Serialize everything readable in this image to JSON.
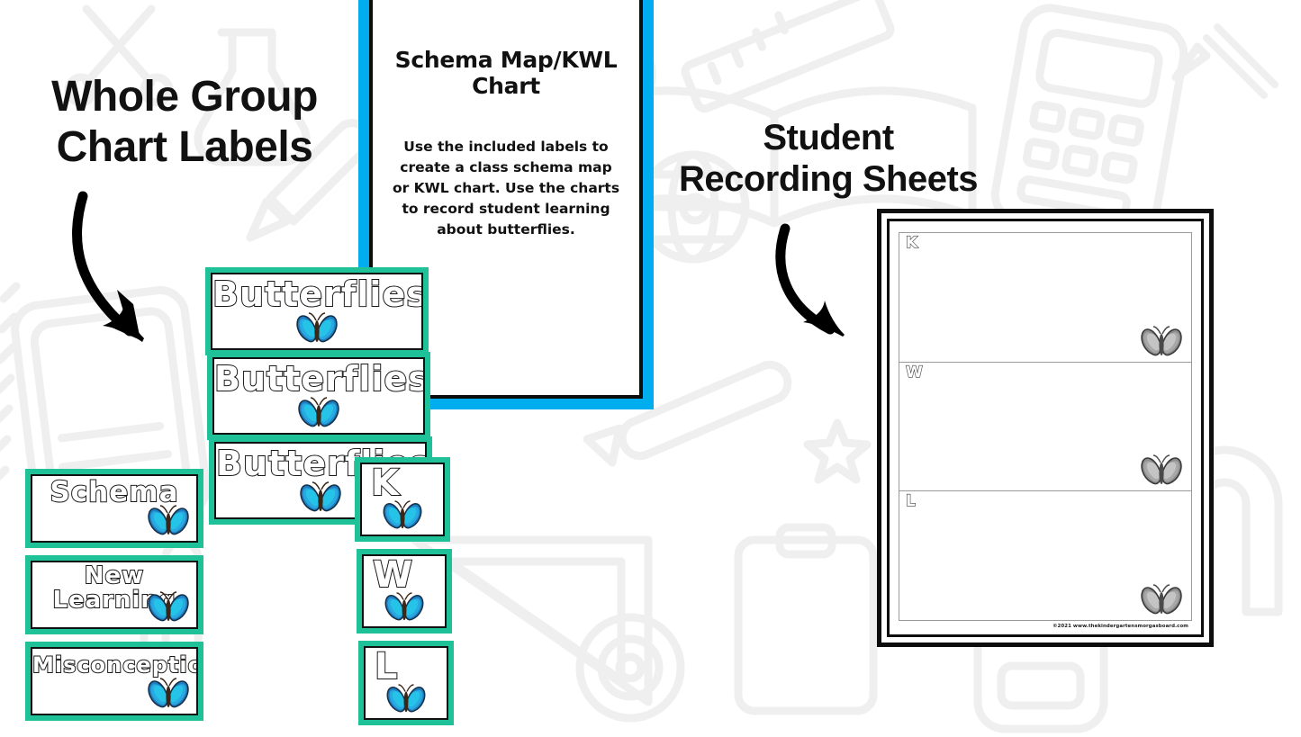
{
  "headings": {
    "left": "Whole Group\nChart Labels",
    "right": "Student\nRecording Sheets"
  },
  "title_card": {
    "heading": "Schema Map/KWL Chart",
    "body": "Use the included labels to create a class schema map or KWL chart. Use the charts to record student learning about butterflies.",
    "border_color": "#00AEEF"
  },
  "chart_labels": {
    "border_color": "#1FC199",
    "butterfly_cards": [
      {
        "text": "Butterflies"
      },
      {
        "text": "Butterflies"
      },
      {
        "text": "Butterflies"
      }
    ],
    "concept_cards": [
      {
        "text": "Schema"
      },
      {
        "text": "New\nLearning"
      },
      {
        "text": "Misconceptions"
      }
    ],
    "kwl_cards": [
      {
        "letter": "K"
      },
      {
        "letter": "W"
      },
      {
        "letter": "L"
      }
    ]
  },
  "recording_sheet": {
    "rows": [
      {
        "letter": "K"
      },
      {
        "letter": "W"
      },
      {
        "letter": "L"
      }
    ],
    "copyright": "©2021 www.thekindergartensmorgasboard.com"
  },
  "icons": {
    "butterfly_color": "butterfly-blue-morpho-icon",
    "butterfly_gray": "butterfly-grayscale-icon",
    "arrow": "curved-arrow-icon"
  }
}
